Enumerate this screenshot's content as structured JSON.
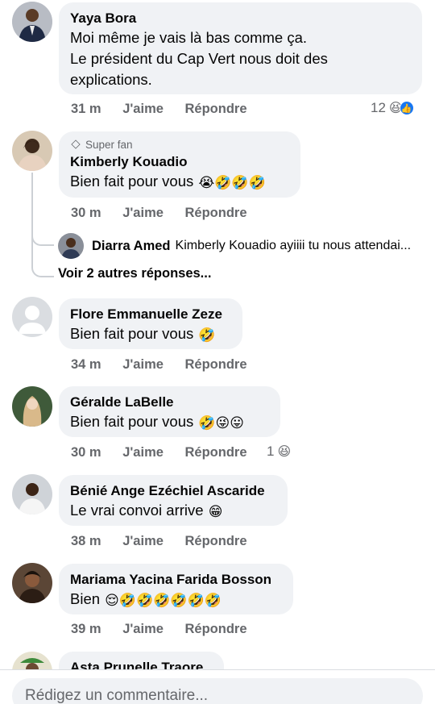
{
  "comments": [
    {
      "author": "Yaya Bora",
      "lines": [
        "Moi même je vais là bas comme ça.",
        "Le président du Cap Vert nous doit des",
        "explications."
      ],
      "time": "31 m",
      "like": "J'aime",
      "reply": "Répondre",
      "reaction_count": "12",
      "reaction_emoji": "😆",
      "reaction_icon": "thumbs-up-icon"
    },
    {
      "badge": "Super fan",
      "author": "Kimberly Kouadio",
      "text": "Bien fait pour vous",
      "emojis": "😭🤣🤣🤣",
      "time": "30 m",
      "like": "J'aime",
      "reply": "Répondre",
      "reply_preview": {
        "author": "Diarra Amed",
        "text": "Kimberly Kouadio ayiiii tu nous attendai..."
      },
      "more_replies": "Voir 2 autres réponses..."
    },
    {
      "author": "Flore Emmanuelle Zeze",
      "text": "Bien fait pour vous",
      "emojis": "🤣",
      "time": "34 m",
      "like": "J'aime",
      "reply": "Répondre"
    },
    {
      "author": "Géralde LaBelle",
      "text": "Bien fait pour vous",
      "emojis": "🤣😜😛",
      "time": "30 m",
      "like": "J'aime",
      "reply": "Répondre",
      "reaction_count": "1",
      "reaction_emoji": "😆"
    },
    {
      "author": "Bénié Ange Ezéchiel Ascaride",
      "text": "Le vrai convoi arrive",
      "emojis": "😁",
      "time": "38 m",
      "like": "J'aime",
      "reply": "Répondre"
    },
    {
      "author": "Mariama Yacina Farida Bosson",
      "text": "Bien",
      "emojis": "😌🤣🤣🤣🤣🤣🤣",
      "time": "39 m",
      "like": "J'aime",
      "reply": "Répondre"
    },
    {
      "author": "Asta Prunelle Traore"
    }
  ],
  "footer": {
    "placeholder": "Rédigez un commentaire..."
  },
  "colors": {
    "bubble": "#f0f2f5",
    "meta_text": "#65676b",
    "like_blue": "#1877f2"
  }
}
